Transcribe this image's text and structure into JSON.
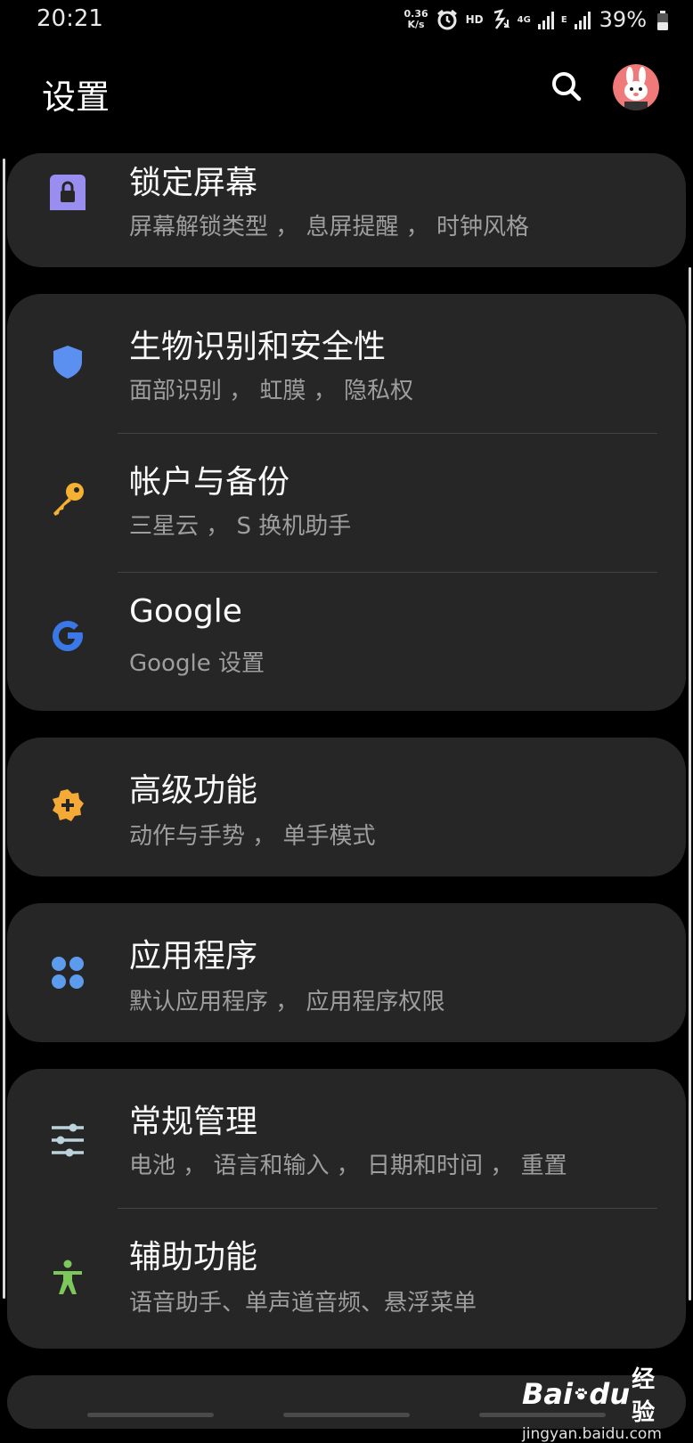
{
  "status_bar": {
    "time": "20:21",
    "net_speed_value": "0.36",
    "net_speed_unit": "K/s",
    "hd": "HD",
    "network_4g": "4G",
    "network_e": "E",
    "battery": "39%",
    "icons": [
      "alarm-icon",
      "bluetooth-icon",
      "signal-icon",
      "battery-icon"
    ]
  },
  "header": {
    "title": "设置",
    "search_icon": "search-icon",
    "avatar_icon": "avatar"
  },
  "items": [
    {
      "title": "锁定屏幕",
      "subtitle": "屏幕解锁类型 ， 息屏提醒 ， 时钟风格",
      "icon": "lock-icon",
      "color": "#9a8df0"
    },
    {
      "title": "生物识别和安全性",
      "subtitle": "面部识别 ， 虹膜 ， 隐私权",
      "icon": "shield-icon",
      "color": "#5b8ff0"
    },
    {
      "title": "帐户与备份",
      "subtitle": "三星云 ， S 换机助手",
      "icon": "key-icon",
      "color": "#f6b133"
    },
    {
      "title": "Google",
      "subtitle": "Google 设置",
      "icon": "google-icon",
      "color": "#3b78e7"
    },
    {
      "title": "高级功能",
      "subtitle": "动作与手势 ， 单手模式",
      "icon": "gear-plus-icon",
      "color": "#f5a936"
    },
    {
      "title": "应用程序",
      "subtitle": "默认应用程序 ， 应用程序权限",
      "icon": "apps-icon",
      "color": "#5d9ced"
    },
    {
      "title": "常规管理",
      "subtitle": "电池 ， 语言和输入 ， 日期和时间 ， 重置",
      "icon": "sliders-icon",
      "color": "#bcd3dc"
    },
    {
      "title": "辅助功能",
      "subtitle": "语音助手、单声道音频、悬浮菜单",
      "icon": "accessibility-icon",
      "color": "#7cc85a"
    }
  ],
  "watermark": {
    "brand_text_1": "Bai",
    "brand_text_2": "du",
    "brand_text_3": "经验",
    "url": "jingyan.baidu.com"
  }
}
